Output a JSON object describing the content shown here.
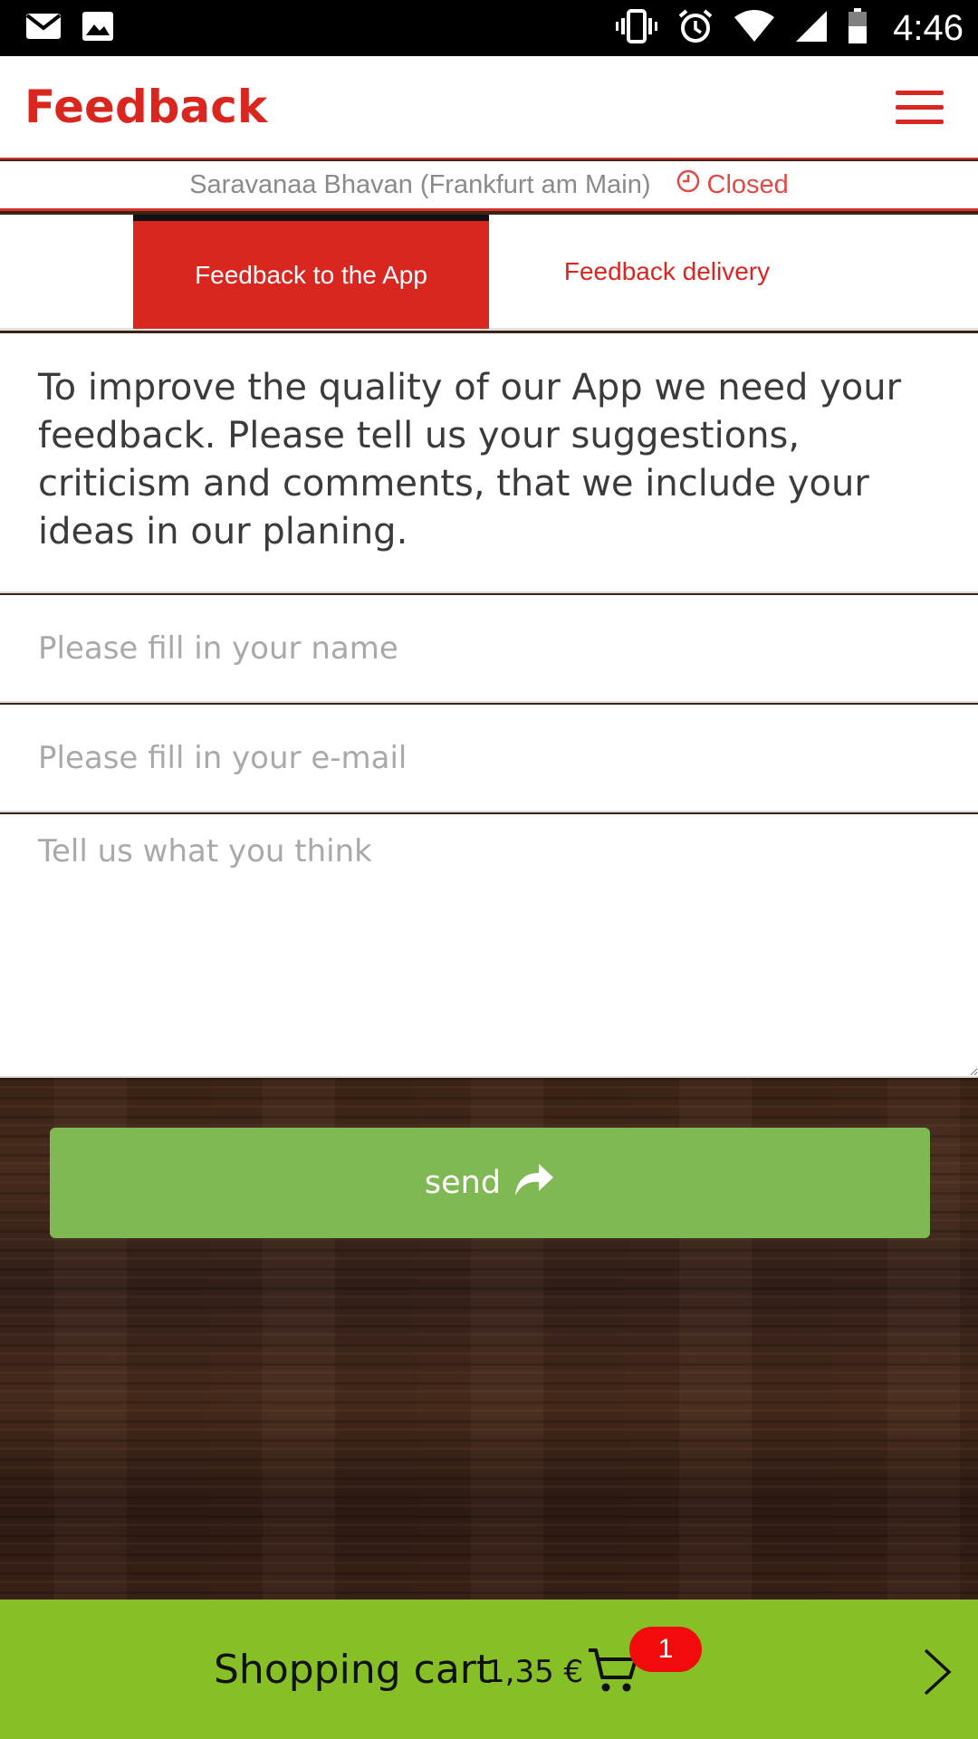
{
  "status_bar": {
    "time": "4:46",
    "icons": [
      "mail-icon",
      "image-icon",
      "vibrate-icon",
      "alarm-icon",
      "wifi-icon",
      "signal-icon",
      "battery-icon"
    ]
  },
  "header": {
    "title": "Feedback",
    "menu_icon": "hamburger-menu-icon"
  },
  "restaurant": {
    "name": "Saravanaa Bhavan (Frankfurt am Main)",
    "status": "Closed"
  },
  "tabs": [
    {
      "label": "Feedback to the App",
      "active": true
    },
    {
      "label": "Feedback delivery",
      "active": false
    }
  ],
  "form": {
    "intro": "To improve the quality of our App we need your feedback. Please tell us your suggestions, criticism and comments, that we include your ideas in our planing.",
    "name_placeholder": "Please fill in your name",
    "email_placeholder": "Please fill in your e-mail",
    "message_placeholder": "Tell us what you think",
    "send_label": "send"
  },
  "cart": {
    "label": "Shopping cart",
    "total": "1,35 €",
    "count": "1"
  },
  "colors": {
    "accent_red": "#d9261f",
    "send_green": "#80b954",
    "cart_green": "#86c026",
    "badge_red": "#f20b0b"
  }
}
